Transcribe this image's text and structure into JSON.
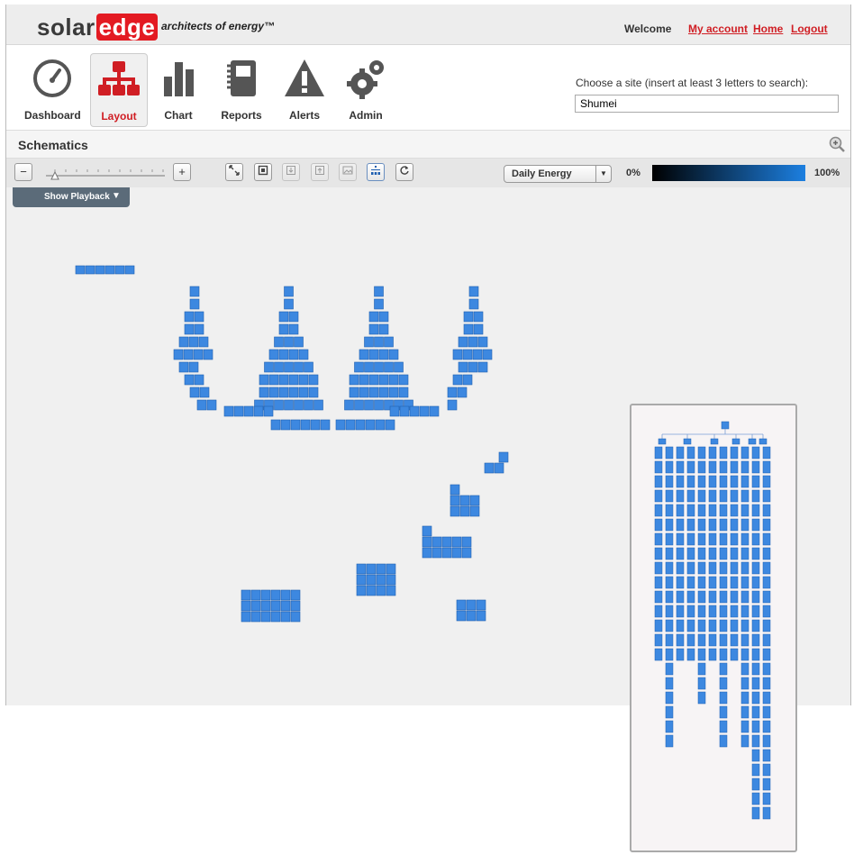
{
  "header": {
    "logo_text_a": "solar",
    "logo_text_b": "edge",
    "tagline": "architects of energy™",
    "welcome": "Welcome",
    "links": {
      "my_account": "My account",
      "home": "Home",
      "logout": "Logout"
    }
  },
  "nav": {
    "dashboard": "Dashboard",
    "layout": "Layout",
    "chart": "Chart",
    "reports": "Reports",
    "alerts": "Alerts",
    "admin": "Admin",
    "active": "Layout"
  },
  "site_search": {
    "label": "Choose a site (insert at least 3 letters to search):",
    "value": "Shumei"
  },
  "schematics": {
    "title": "Schematics"
  },
  "toolbar": {
    "energy_dropdown": "Daily Energy",
    "pct_min": "0%",
    "pct_max": "100%",
    "minus_label": "−",
    "plus_label": "+"
  },
  "playback": {
    "label": "Show Playback"
  },
  "colors": {
    "accent": "#d01e24",
    "panel": "#3d88e0",
    "panel_dark": "#1f5fb0",
    "gradient_start": "#000000",
    "gradient_end": "#1c7fe0"
  },
  "icons": [
    "dashboard-gauge-icon",
    "layout-hierarchy-icon",
    "chart-bars-icon",
    "reports-notebook-icon",
    "alerts-warning-icon",
    "admin-gears-icon",
    "zoom-in-icon",
    "fit-screen-icon",
    "expand-icon",
    "import-icon",
    "export-icon",
    "image-icon",
    "hierarchy-toggle-icon",
    "refresh-icon",
    "dropdown-arrow-icon"
  ]
}
